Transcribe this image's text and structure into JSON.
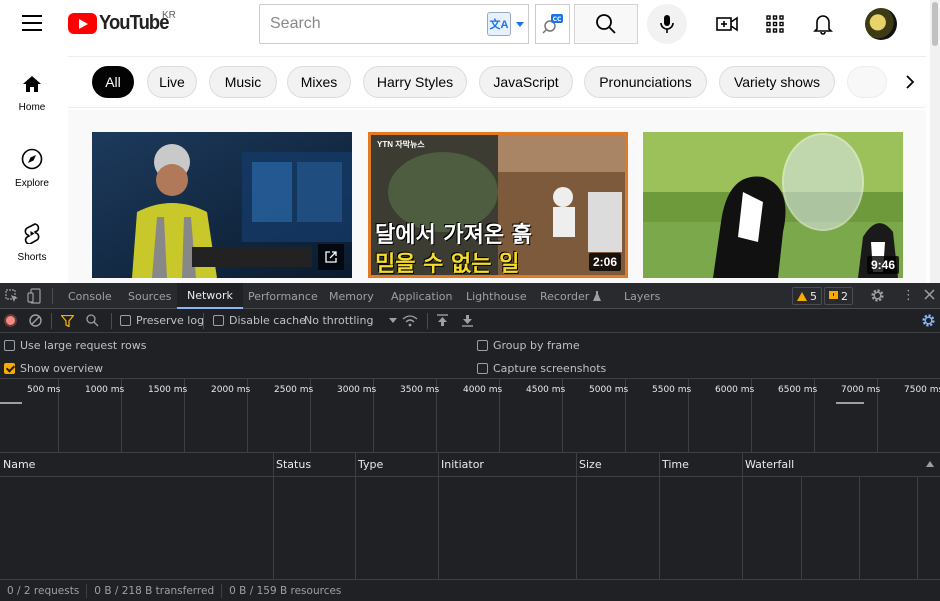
{
  "youtube": {
    "logo_text": "YouTube",
    "country_code": "KR",
    "search_placeholder": "Search",
    "translate_glyph": "文A",
    "cc_glyph": "CC",
    "sidebar": [
      {
        "label": "Home",
        "icon": "home-icon"
      },
      {
        "label": "Explore",
        "icon": "compass-icon"
      },
      {
        "label": "Shorts",
        "icon": "shorts-icon"
      }
    ],
    "chips": [
      "All",
      "Live",
      "Music",
      "Mixes",
      "Harry Styles",
      "JavaScript",
      "Pronunciations",
      "Variety shows"
    ],
    "videos": [
      {
        "duration": "",
        "overlay_text": ""
      },
      {
        "duration": "2:06",
        "channel_tag": "YTN 자막뉴스",
        "caption_line1": "달에서 가져온 흙",
        "caption_line2": "믿을 수 없는 일"
      },
      {
        "duration": "9:46",
        "overlay_text": ""
      }
    ]
  },
  "devtools": {
    "tabs": [
      "Console",
      "Sources",
      "Network",
      "Performance",
      "Memory",
      "Application",
      "Lighthouse",
      "Recorder",
      "Layers"
    ],
    "active_tab": "Network",
    "warning_count": "5",
    "issue_count": "2",
    "toolbar": {
      "preserve_log": "Preserve log",
      "disable_cache": "Disable cache",
      "throttling": "No throttling"
    },
    "settings": {
      "large_rows": "Use large request rows",
      "show_overview": "Show overview",
      "group_by_frame": "Group by frame",
      "capture_screenshots": "Capture screenshots"
    },
    "timeline_ticks": [
      "500 ms",
      "1000 ms",
      "1500 ms",
      "2000 ms",
      "2500 ms",
      "3000 ms",
      "3500 ms",
      "4000 ms",
      "4500 ms",
      "5000 ms",
      "5500 ms",
      "6000 ms",
      "6500 ms",
      "7000 ms",
      "7500 ms"
    ],
    "columns": [
      "Name",
      "Status",
      "Type",
      "Initiator",
      "Size",
      "Time",
      "Waterfall"
    ],
    "status_bar": {
      "requests": "0 / 2 requests",
      "transferred": "0 B / 218 B transferred",
      "resources": "0 B / 159 B resources"
    },
    "colors": {
      "accent": "#8ab4f8",
      "background": "#202124",
      "record": "#f28b82"
    }
  }
}
